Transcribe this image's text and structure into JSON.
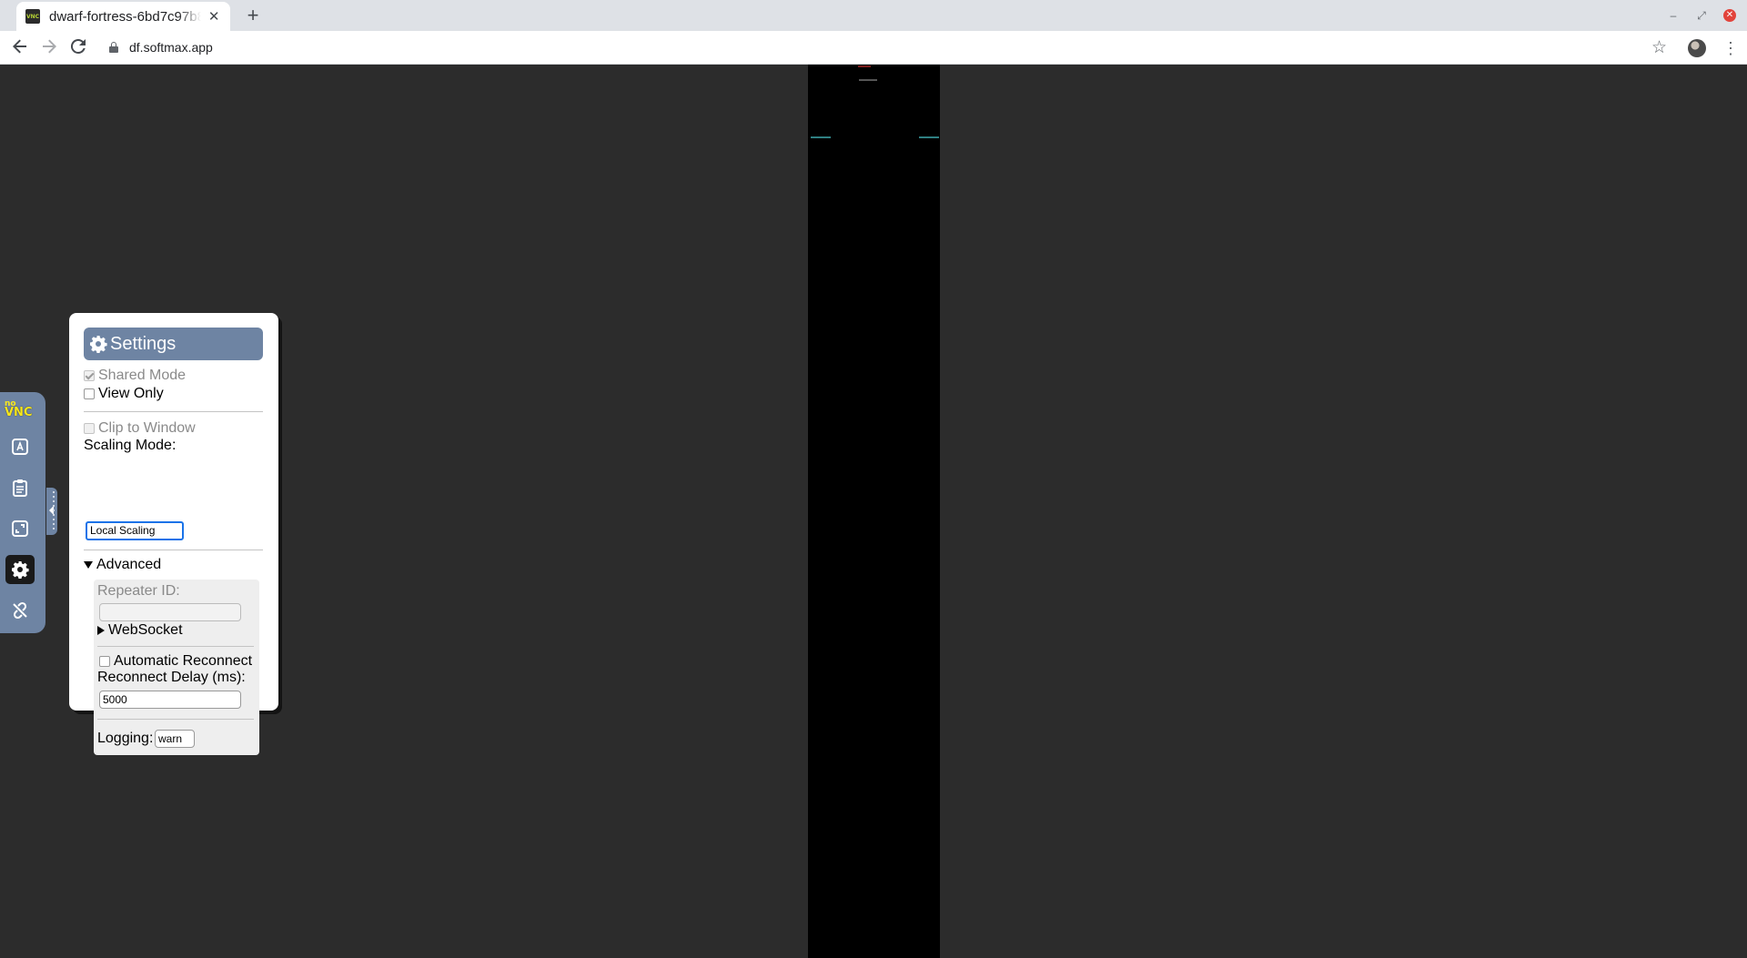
{
  "browser": {
    "tab_title": "dwarf-fortress-6bd7c97b8",
    "tab_favicon_text": "VNC",
    "tab_close_glyph": "✕",
    "new_tab_glyph": "+",
    "url": "df.softmax.app",
    "window_controls": {
      "minimize": "–",
      "restore": "⤢",
      "close": "✕"
    }
  },
  "novnc": {
    "logo_top": "no",
    "logo_bottom": "VNC",
    "toolbar_buttons": [
      {
        "name": "extra-keys",
        "icon": "keyboard-a-icon",
        "active": false
      },
      {
        "name": "clipboard",
        "icon": "clipboard-icon",
        "active": false
      },
      {
        "name": "fullscreen",
        "icon": "fullscreen-icon",
        "active": false
      },
      {
        "name": "settings",
        "icon": "gear-icon",
        "active": true
      },
      {
        "name": "disconnect",
        "icon": "disconnect-icon",
        "active": false
      }
    ],
    "accent_color": "#6e84a3"
  },
  "settings": {
    "title": "Settings",
    "shared_mode": {
      "label": "Shared Mode",
      "checked": true,
      "disabled": true
    },
    "view_only": {
      "label": "View Only",
      "checked": false
    },
    "clip_to_window": {
      "label": "Clip to Window",
      "checked": false,
      "disabled": true
    },
    "scaling_mode_label": "Scaling Mode:",
    "scaling_mode_value": "Local Scaling",
    "advanced_label": "Advanced",
    "repeater_id_label": "Repeater ID:",
    "repeater_id_value": "",
    "websocket_label": "WebSocket",
    "auto_reconnect": {
      "label": "Automatic Reconnect",
      "checked": false
    },
    "reconnect_delay_label": "Reconnect Delay (ms):",
    "reconnect_delay_value": "5000",
    "logging_label": "Logging:",
    "logging_value": "warn"
  }
}
